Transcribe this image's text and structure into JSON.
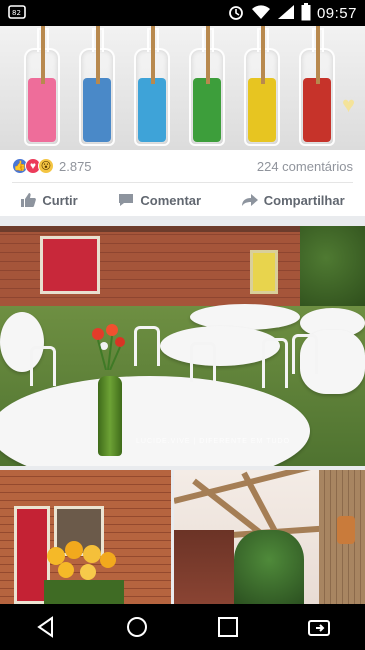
{
  "status_bar": {
    "time": "09:57",
    "icons": [
      "screen-mirror-icon",
      "alarm-icon",
      "wifi-icon",
      "signal-icon",
      "battery-icon"
    ]
  },
  "post": {
    "reactions": {
      "types": [
        "like",
        "love",
        "wow"
      ],
      "count": "2.875"
    },
    "comments_count": "224 comentários",
    "actions": {
      "like_label": "Curtir",
      "comment_label": "Comentar",
      "share_label": "Compartilhar"
    }
  },
  "photos": {
    "bottles": {
      "colors": [
        "#ee6d9a",
        "#4a89c8",
        "#3ea3d8",
        "#3d9e3b",
        "#e7c521",
        "#c6332a"
      ]
    },
    "garden": {
      "caption": "LUCIDE.VIVE | DIFERENTE EM TUDO"
    }
  },
  "nav_bar": {
    "buttons": [
      "back-icon",
      "home-icon",
      "recents-icon",
      "rotate-screen-icon"
    ]
  }
}
